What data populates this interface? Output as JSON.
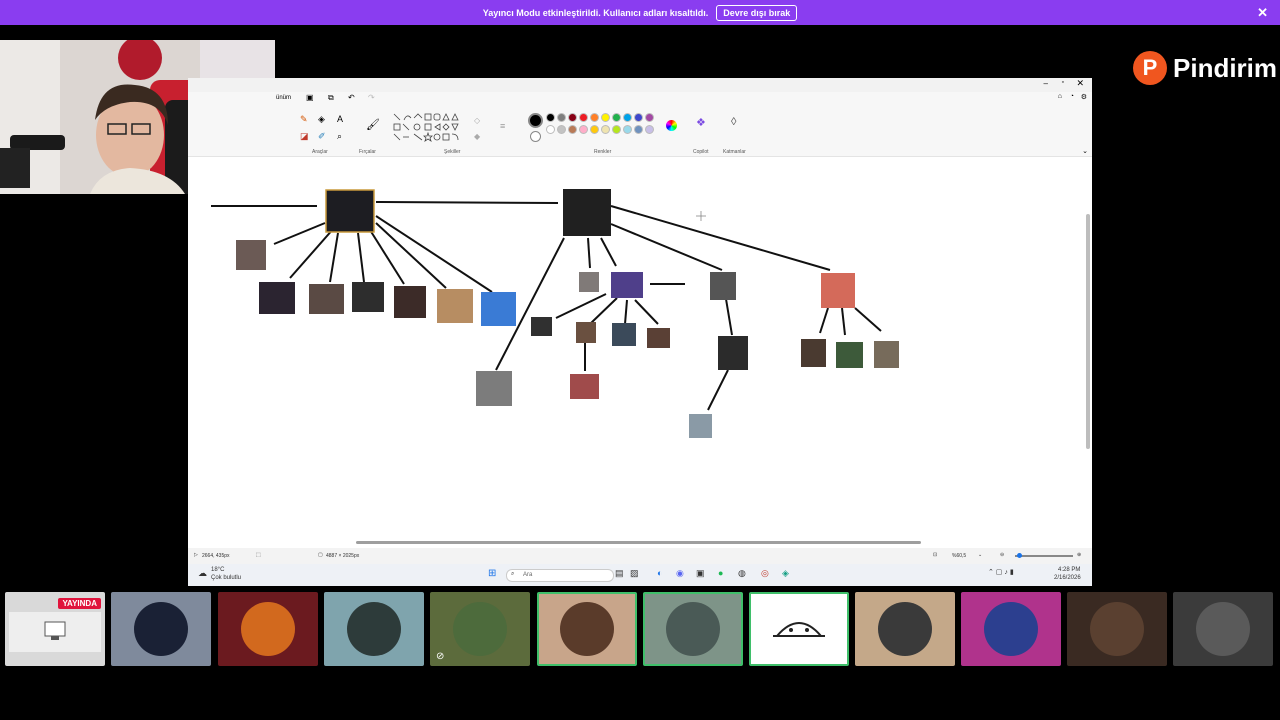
{
  "banner": {
    "message": "Yayıncı Modu etkinleştirildi. Kullanıcı adları kısaltıldı.",
    "disable_button": "Devre dışı bırak"
  },
  "brand": {
    "name": "Pindirim"
  },
  "paint": {
    "menu_label": "ünüm",
    "ribbon_groups": {
      "tools": "Araçlar",
      "brushes": "Fırçalar",
      "shapes": "Şekiller",
      "colors": "Renkler",
      "copilot": "Copilot",
      "layers": "Katmanlar"
    },
    "palette": [
      "#000000",
      "#7f7f7f",
      "#880015",
      "#ed1c24",
      "#ff7f27",
      "#fff200",
      "#22b14c",
      "#00a2e8",
      "#3f48cc",
      "#a349a4",
      "#ffffff",
      "#c3c3c3",
      "#b97a57",
      "#ffaec9",
      "#ffc90e",
      "#efe4b0",
      "#b5e61d",
      "#99d9ea",
      "#7092be",
      "#c8bfe7"
    ],
    "status": {
      "cursor_pos": "2664, 435px",
      "canvas_size": "4887 × 2025px",
      "zoom": "%60,5"
    }
  },
  "taskbar": {
    "weather_temp": "18°C",
    "weather_desc": "Çok bulutlu",
    "search_placeholder": "Ara",
    "time": "4:28 PM",
    "date": "2/16/2026"
  },
  "thumbnails": {
    "live_label": "YAYINDA",
    "items": [
      {
        "bg": "#d9d9d9",
        "avatar": "#6f6f6f"
      },
      {
        "bg": "#7f8a9c",
        "avatar": "#1a2135"
      },
      {
        "bg": "#6b1a1f",
        "avatar": "#d2691e"
      },
      {
        "bg": "#7fa4ad",
        "avatar": "#2d3b3a"
      },
      {
        "bg": "#5c6b3c",
        "avatar": "#4d6b3c"
      },
      {
        "bg": "#c8a58a",
        "avatar": "#5a3b2a"
      },
      {
        "bg": "#7e9488",
        "avatar": "#4a5a56"
      },
      {
        "bg": "#ffffff",
        "avatar": "#ffffff"
      },
      {
        "bg": "#c4a889",
        "avatar": "#3a3a3a"
      },
      {
        "bg": "#b0338c",
        "avatar": "#2c3f8f"
      },
      {
        "bg": "#3a2a22",
        "avatar": "#5a4030"
      },
      {
        "bg": "#3b3b3b",
        "avatar": "#5a5a5a"
      }
    ]
  }
}
